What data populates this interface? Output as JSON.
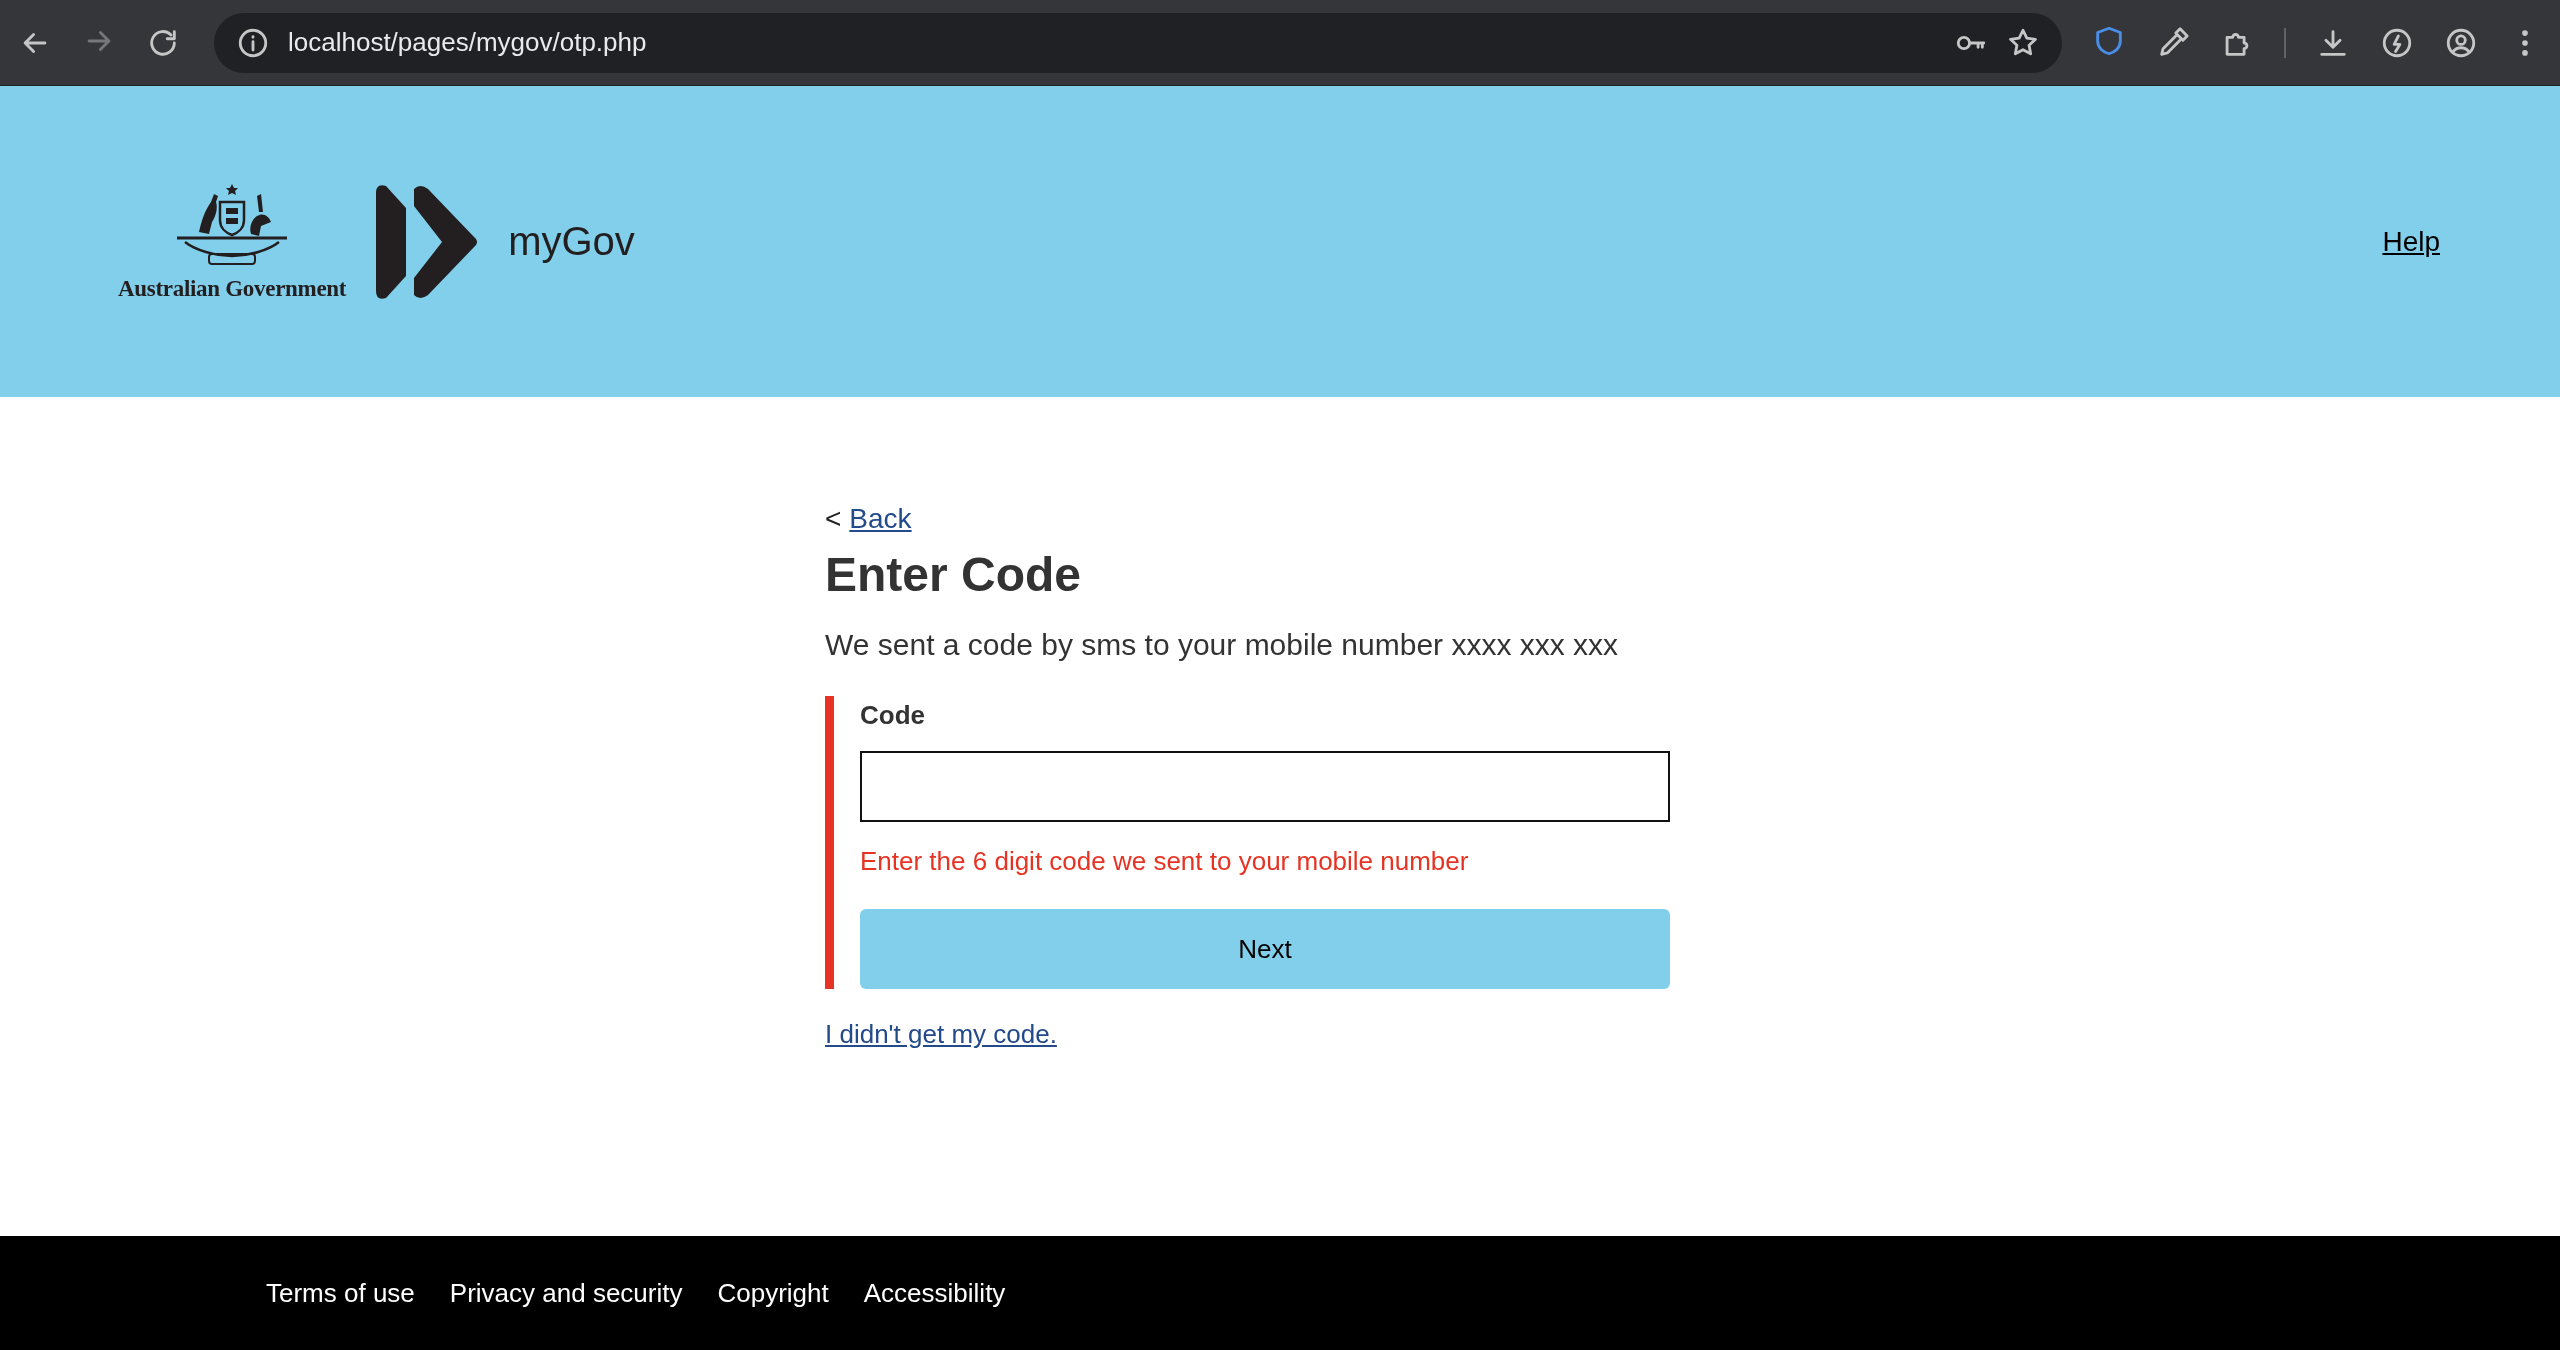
{
  "browser": {
    "url": "localhost/pages/mygov/otp.php"
  },
  "header": {
    "government_name": "Australian Government",
    "brand": "myGov",
    "help_link": "Help"
  },
  "main": {
    "back_prefix": "<",
    "back_link": "Back",
    "title": "Enter Code",
    "message": "We sent a code by sms to your mobile number xxxx xxx xxx",
    "field": {
      "label": "Code",
      "invalid": true,
      "error": "Enter the 6 digit code we sent to your mobile number"
    },
    "button": "Next",
    "help_link": "I didn't get my code."
  },
  "footer": {
    "links": [
      "Terms of use",
      "Privacy and security",
      "Copyright",
      "Accessibility"
    ]
  }
}
